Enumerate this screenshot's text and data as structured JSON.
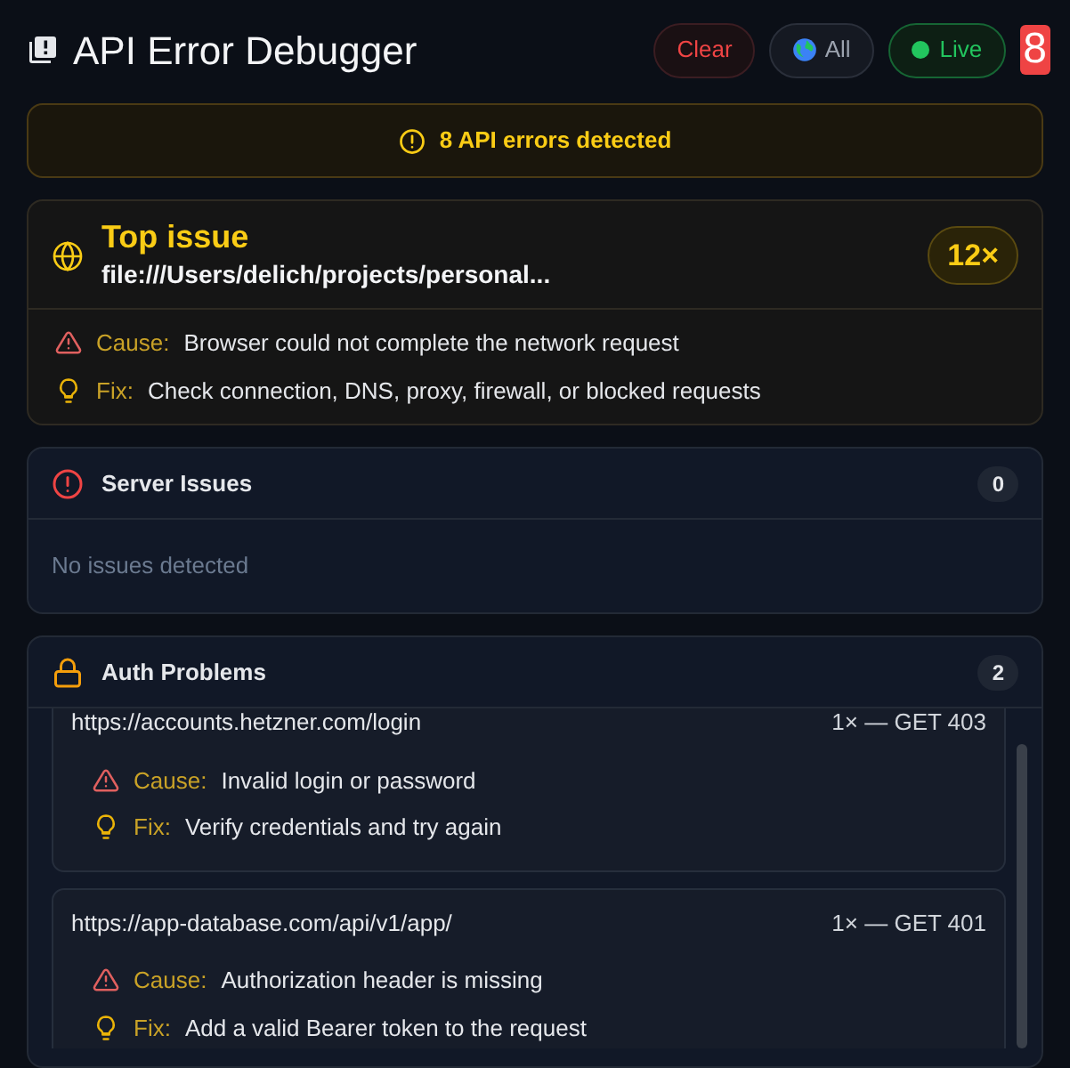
{
  "header": {
    "title": "API Error Debugger",
    "buttons": [
      {
        "kind": "clear",
        "label": "Clear"
      },
      {
        "kind": "filter",
        "label": "All"
      },
      {
        "kind": "live",
        "label": "Live",
        "on": true
      }
    ],
    "badge": "8"
  },
  "banner": "8 API errors detected",
  "top_issue": {
    "title": "Top issue",
    "url": "file:///Users/delich/projects/personal...",
    "count": "12×",
    "cause_label": "Cause:",
    "cause": "Browser could not complete the network request",
    "fix_label": "Fix:",
    "fix": "Check connection, DNS, proxy, firewall, or blocked requests"
  },
  "sections": [
    {
      "kind": "server",
      "title": "Server Issues",
      "count": "0",
      "empty": "No issues detected"
    },
    {
      "kind": "auth",
      "title": "Auth Problems",
      "count": "2",
      "items": [
        {
          "url": "https://accounts.hetzner.com/login",
          "meta": "1× — GET 403",
          "cause_label": "Cause:",
          "cause": "Invalid login or password",
          "fix_label": "Fix:",
          "fix": "Verify credentials and try again"
        },
        {
          "url": "https://app-database.com/api/v1/app/",
          "meta": "1× — GET 401",
          "cause_label": "Cause:",
          "cause": "Authorization header is missing",
          "fix_label": "Fix:",
          "fix": "Add a valid Bearer token to the request"
        }
      ]
    }
  ]
}
